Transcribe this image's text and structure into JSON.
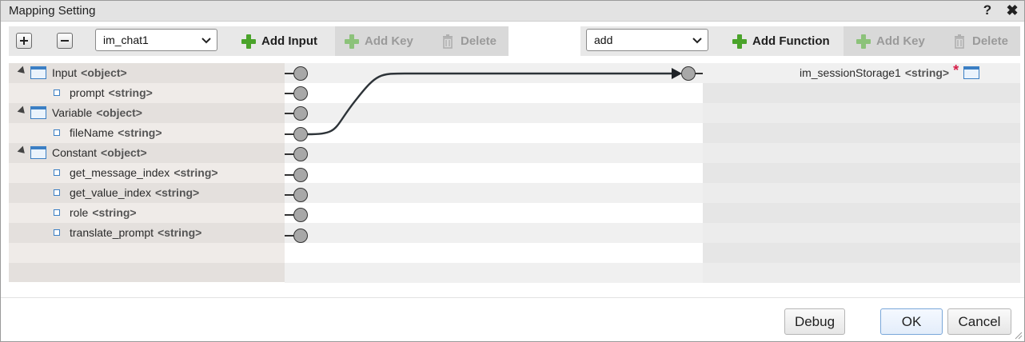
{
  "dialog": {
    "title": "Mapping Setting",
    "help_label": "?",
    "close_label": "✖"
  },
  "toolbar_left": {
    "expand_icon": "plus-icon",
    "collapse_icon": "minus-icon",
    "source_select": "im_chat1",
    "add_input": "Add Input",
    "add_key": "Add Key",
    "delete": "Delete"
  },
  "toolbar_right": {
    "function_select": "add",
    "add_function": "Add Function",
    "add_key": "Add Key",
    "delete": "Delete"
  },
  "source_tree": [
    {
      "name": "Input",
      "type": "<object>",
      "level": 0
    },
    {
      "name": "prompt",
      "type": "<string>",
      "level": 1
    },
    {
      "name": "Variable",
      "type": "<object>",
      "level": 0
    },
    {
      "name": "fileName",
      "type": "<string>",
      "level": 1
    },
    {
      "name": "Constant",
      "type": "<object>",
      "level": 0
    },
    {
      "name": "get_message_index",
      "type": "<string>",
      "level": 1
    },
    {
      "name": "get_value_index",
      "type": "<string>",
      "level": 1
    },
    {
      "name": "role",
      "type": "<string>",
      "level": 1
    },
    {
      "name": "translate_prompt",
      "type": "<string>",
      "level": 1
    }
  ],
  "target_tree": [
    {
      "name": "im_sessionStorage1",
      "type": "<string>",
      "required_mark": "*"
    }
  ],
  "footer": {
    "debug": "Debug",
    "ok": "OK",
    "cancel": "Cancel"
  },
  "colors": {
    "accent_green": "#4aa32a",
    "node_icon_blue": "#3b7fc4",
    "required_red": "#d6204a"
  }
}
